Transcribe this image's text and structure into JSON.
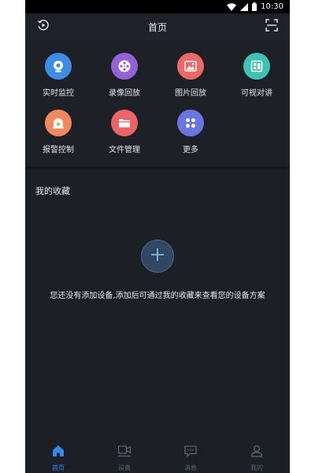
{
  "status_bar": {
    "time": "10:30"
  },
  "header": {
    "title": "首页",
    "left_icon": "playback-circle-icon",
    "right_icon": "scan-icon"
  },
  "features": [
    {
      "label": "实时监控",
      "icon": "camera-icon",
      "color": "#3d8de6"
    },
    {
      "label": "录像回放",
      "icon": "film-reel-icon",
      "color": "#9561d6"
    },
    {
      "label": "图片回放",
      "icon": "image-icon",
      "color": "#ee6868"
    },
    {
      "label": "可视对讲",
      "icon": "intercom-icon",
      "color": "#3dc3b4"
    },
    {
      "label": "报警控制",
      "icon": "alarm-icon",
      "color": "#f08a5d"
    },
    {
      "label": "文件管理",
      "icon": "folder-icon",
      "color": "#ee6466"
    },
    {
      "label": "更多",
      "icon": "more-grid-icon",
      "color": "#6a76e0"
    }
  ],
  "favorites": {
    "title": "我的收藏",
    "empty_message": "您还没有添加设备,添加后可通过我的收藏来查看您的设备方案"
  },
  "bottom_nav": [
    {
      "label": "首页",
      "icon": "home-icon",
      "active": true
    },
    {
      "label": "设备",
      "icon": "device-icon",
      "active": false
    },
    {
      "label": "消息",
      "icon": "message-icon",
      "active": false
    },
    {
      "label": "我的",
      "icon": "profile-icon",
      "active": false
    }
  ],
  "colors": {
    "accent": "#2e8cf0",
    "background": "#1c1f26"
  }
}
